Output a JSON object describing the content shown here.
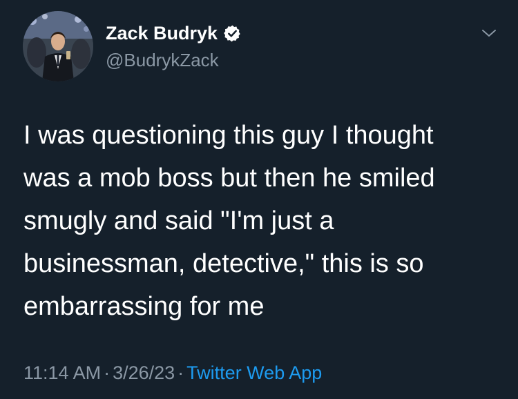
{
  "author": {
    "name": "Zack Budryk",
    "handle": "@BudrykZack",
    "verified": true,
    "avatar_icon": "profile-photo",
    "verified_icon": "verified-badge-icon"
  },
  "menu_icon": "chevron-down-icon",
  "tweet": {
    "lines": [
      "I was questioning this guy I thought",
      "was a mob boss but then he smiled",
      "smugly and said \"I'm just a",
      "businessman, detective,\" this is so",
      "embarrassing for me"
    ]
  },
  "meta": {
    "time": "11:14 AM",
    "date": "3/26/23",
    "source": "Twitter Web App",
    "separator": "·"
  },
  "colors": {
    "background": "#15202b",
    "text": "#ffffff",
    "secondary": "#8b98a5",
    "accent": "#1d9bf0"
  }
}
